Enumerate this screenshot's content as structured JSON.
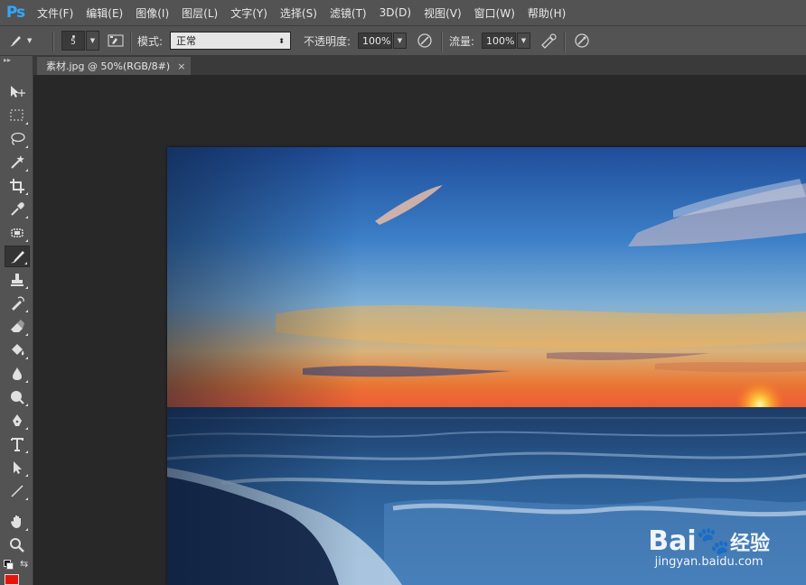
{
  "app": {
    "logo": "Ps"
  },
  "menu": [
    "文件(F)",
    "编辑(E)",
    "图像(I)",
    "图层(L)",
    "文字(Y)",
    "选择(S)",
    "滤镜(T)",
    "3D(D)",
    "视图(V)",
    "窗口(W)",
    "帮助(H)"
  ],
  "options": {
    "brush_size": "5",
    "mode_label": "模式:",
    "mode_value": "正常",
    "opacity_label": "不透明度:",
    "opacity_value": "100%",
    "flow_label": "流量:",
    "flow_value": "100%"
  },
  "document": {
    "tab_title": "素材.jpg @ 50%(RGB/8#)",
    "close_glyph": "×"
  },
  "watermark": {
    "brand": "Bai",
    "brand_suffix": "经验",
    "url": "jingyan.baidu.com"
  },
  "colors": {
    "foreground": "#e8140c",
    "background": "#ffffff",
    "accent": "#31a8ff"
  },
  "tools": [
    "move-tool",
    "marquee-tool",
    "lasso-tool",
    "magic-wand-tool",
    "crop-tool",
    "eyedropper-tool",
    "healing-brush-tool",
    "brush-tool",
    "clone-stamp-tool",
    "history-brush-tool",
    "eraser-tool",
    "paint-bucket-tool",
    "blur-tool",
    "dodge-tool",
    "pen-tool",
    "type-tool",
    "path-selection-tool",
    "line-tool",
    "hand-tool",
    "zoom-tool"
  ],
  "active_tool": "brush-tool"
}
